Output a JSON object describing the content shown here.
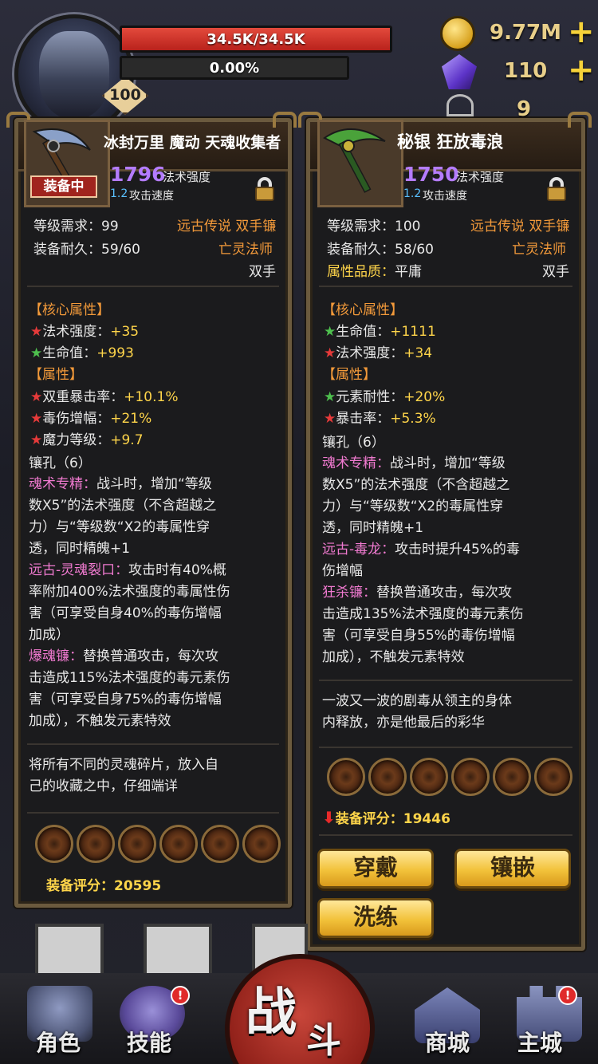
{
  "hud": {
    "level": "100",
    "hp_text": "34.5K/34.5K",
    "hp_fraction": 1.0,
    "xp_text": "0.00%",
    "gold": "9.77M",
    "gems": "110",
    "keys": "9",
    "plus": "+"
  },
  "left": {
    "title": "冰封万里 魔动 天魂收集者",
    "equipped_tag": "装备中",
    "power_num": "1796",
    "power_label": "法术强度",
    "speed_num": "1.2",
    "speed_label": "攻击速度",
    "req_label": "等级需求：",
    "req_value": "99",
    "type": "远古传说 双手镰",
    "dur_label": "装备耐久：",
    "dur_value": "59/60",
    "cls": "亡灵法师",
    "hand": "双手",
    "core_header": "【核心属性】",
    "core": [
      {
        "star": "★",
        "color": "red",
        "label": "法术强度：",
        "value": "+35"
      },
      {
        "star": "★",
        "color": "green",
        "label": "生命值：",
        "value": "+993"
      }
    ],
    "attr_header": "【属性】",
    "attrs": [
      {
        "star": "★",
        "color": "red",
        "label": "双重暴击率：",
        "value": "+10.1%"
      },
      {
        "star": "★",
        "color": "red",
        "label": "毒伤增幅：",
        "value": "+21%"
      },
      {
        "star": "★",
        "color": "red",
        "label": "魔力等级：",
        "value": "+9.7"
      }
    ],
    "sockets_label": "镶孔（6）",
    "skill1_name": "魂术专精：",
    "skill1_l1": "战斗时，增加“等级",
    "skill1_l2": "数X5”的法术强度（不含超越之",
    "skill1_l3": "力）与“等级数“X2的毒属性穿",
    "skill1_l4": "透，同时精魄+1",
    "skill2_name": "远古-灵魂裂口：",
    "skill2_l1": "攻击时有40%概",
    "skill2_l2": "率附加400%法术强度的毒属性伤",
    "skill2_l3": "害（可享受自身40%的毒伤增幅",
    "skill2_l4": "加成）",
    "skill3_name": "爆魂镰：",
    "skill3_l1": "替换普通攻击，每次攻",
    "skill3_l2": "击造成115%法术强度的毒元素伤",
    "skill3_l3": "害（可享受自身75%的毒伤增幅",
    "skill3_l4": "加成），不触发元素特效",
    "flavor_l1": "将所有不同的灵魂碎片，放入自",
    "flavor_l2": "己的收藏之中，仔细端详",
    "score_label": "装备评分：",
    "score_value": "20595"
  },
  "right": {
    "title": "秘银 狂放毒浪",
    "power_num": "1750",
    "power_label": "法术强度",
    "speed_num": "1.2",
    "speed_label": "攻击速度",
    "req_label": "等级需求：",
    "req_value": "100",
    "type": "远古传说 双手镰",
    "dur_label": "装备耐久：",
    "dur_value": "58/60",
    "cls": "亡灵法师",
    "quality_label": "属性品质：",
    "quality_value": "平庸",
    "hand": "双手",
    "core_header": "【核心属性】",
    "core": [
      {
        "star": "★",
        "color": "green",
        "label": "生命值：",
        "value": "+1111"
      },
      {
        "star": "★",
        "color": "red",
        "label": "法术强度：",
        "value": "+34"
      }
    ],
    "attr_header": "【属性】",
    "attrs": [
      {
        "star": "★",
        "color": "green",
        "label": "元素耐性：",
        "value": "+20%"
      },
      {
        "star": "★",
        "color": "red",
        "label": "暴击率：",
        "value": "+5.3%"
      }
    ],
    "sockets_label": "镶孔（6）",
    "skill1_name": "魂术专精：",
    "skill1_l1": "战斗时，增加“等级",
    "skill1_l2": "数X5”的法术强度（不含超越之",
    "skill1_l3": "力）与“等级数“X2的毒属性穿",
    "skill1_l4": "透，同时精魄+1",
    "skill2_name": "远古-毒龙：",
    "skill2_l1": "攻击时提升45%的毒",
    "skill2_l2": "伤增幅",
    "skill3_name": "狂杀镰：",
    "skill3_l1": "替换普通攻击，每次攻",
    "skill3_l2": "击造成135%法术强度的毒元素伤",
    "skill3_l3": "害（可享受自身55%的毒伤增幅",
    "skill3_l4": "加成），不触发元素特效",
    "flavor_l1": "一波又一波的剧毒从领主的身体",
    "flavor_l2": "内释放，亦是他最后的彩华",
    "score_arrow": "⬇",
    "score_label": "装备评分：",
    "score_value": "19446",
    "btn_wear": "穿戴",
    "btn_inlay": "镶嵌",
    "btn_reforge": "洗练"
  },
  "nav": {
    "role": "角色",
    "skill": "技能",
    "fight_1": "战",
    "fight_2": "斗",
    "shop": "商城",
    "city": "主城",
    "alert": "!"
  },
  "colors": {
    "red_star": "#e63a3a",
    "green_star": "#4ec04e",
    "purple": "#b47cff",
    "pink": "#f07ad0",
    "orange": "#f39a3a",
    "gold": "#ffd54a"
  }
}
